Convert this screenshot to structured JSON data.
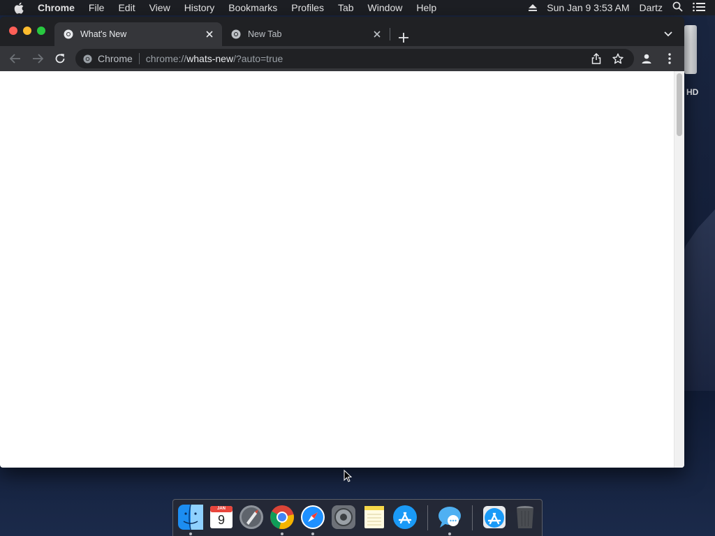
{
  "menubar": {
    "app_name": "Chrome",
    "items": [
      "File",
      "Edit",
      "View",
      "History",
      "Bookmarks",
      "Profiles",
      "Tab",
      "Window",
      "Help"
    ],
    "datetime": "Sun Jan 9  3:53 AM",
    "user": "Dartz"
  },
  "desktop": {
    "hd_label": "HD"
  },
  "tabs": [
    {
      "title": "What's New",
      "active": true
    },
    {
      "title": "New Tab",
      "active": false
    }
  ],
  "omnibox": {
    "site_chip": "Chrome",
    "url_scheme": "chrome://",
    "url_host": "whats-new",
    "url_path": "/?auto=true"
  },
  "dock": {
    "calendar_month": "JAN",
    "calendar_day": "9",
    "apps": [
      "finder-icon",
      "calendar-icon",
      "launchpad-icon",
      "chrome-icon",
      "safari-icon",
      "system-preferences-icon",
      "notes-icon",
      "app-store-icon",
      "messages-icon",
      "app-store-icon",
      "trash-icon"
    ]
  },
  "colors": {
    "window_bg": "#202124",
    "toolbar_bg": "#35363a",
    "content_bg": "#ffffff"
  }
}
